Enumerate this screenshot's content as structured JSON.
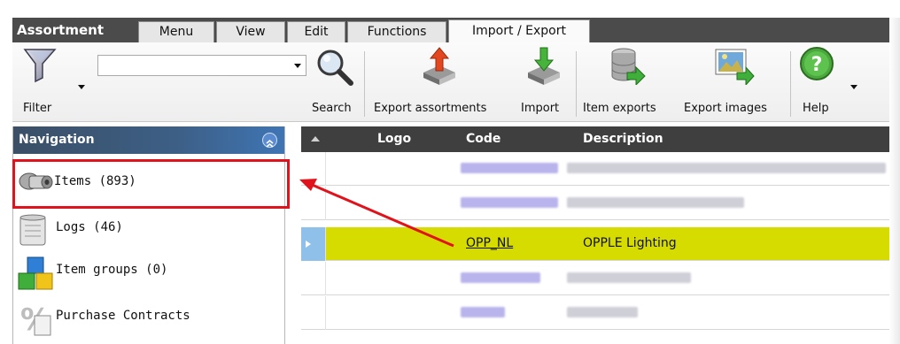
{
  "app": {
    "title": "Assortment"
  },
  "tabs": [
    {
      "label": "Menu",
      "active": false
    },
    {
      "label": "View",
      "active": false
    },
    {
      "label": "Edit",
      "active": false
    },
    {
      "label": "Functions",
      "active": false
    },
    {
      "label": "Import / Export",
      "active": true
    }
  ],
  "toolbar": {
    "filter_label": "Filter",
    "search_value": "",
    "search_label": "Search",
    "export_assortments_label": "Export assortments",
    "import_label": "Import",
    "item_exports_label": "Item exports",
    "export_images_label": "Export images",
    "help_label": "Help"
  },
  "navigation": {
    "title": "Navigation",
    "items": [
      {
        "label": "Items (893)",
        "icon": "items-icon"
      },
      {
        "label": "Logs (46)",
        "icon": "logs-icon"
      },
      {
        "label": "Item groups (0)",
        "icon": "item-groups-icon"
      },
      {
        "label": "Purchase Contracts",
        "icon": "purchase-contracts-icon"
      }
    ]
  },
  "grid": {
    "columns": [
      "Logo",
      "Code",
      "Description"
    ],
    "selected_row": {
      "code": "OPP_NL",
      "description": "OPPLE Lighting"
    }
  },
  "colors": {
    "selection": "#d7dc00",
    "annotation": "#e0121b",
    "nav_header": "#3d5f86",
    "grid_header": "#3f3f3f"
  }
}
